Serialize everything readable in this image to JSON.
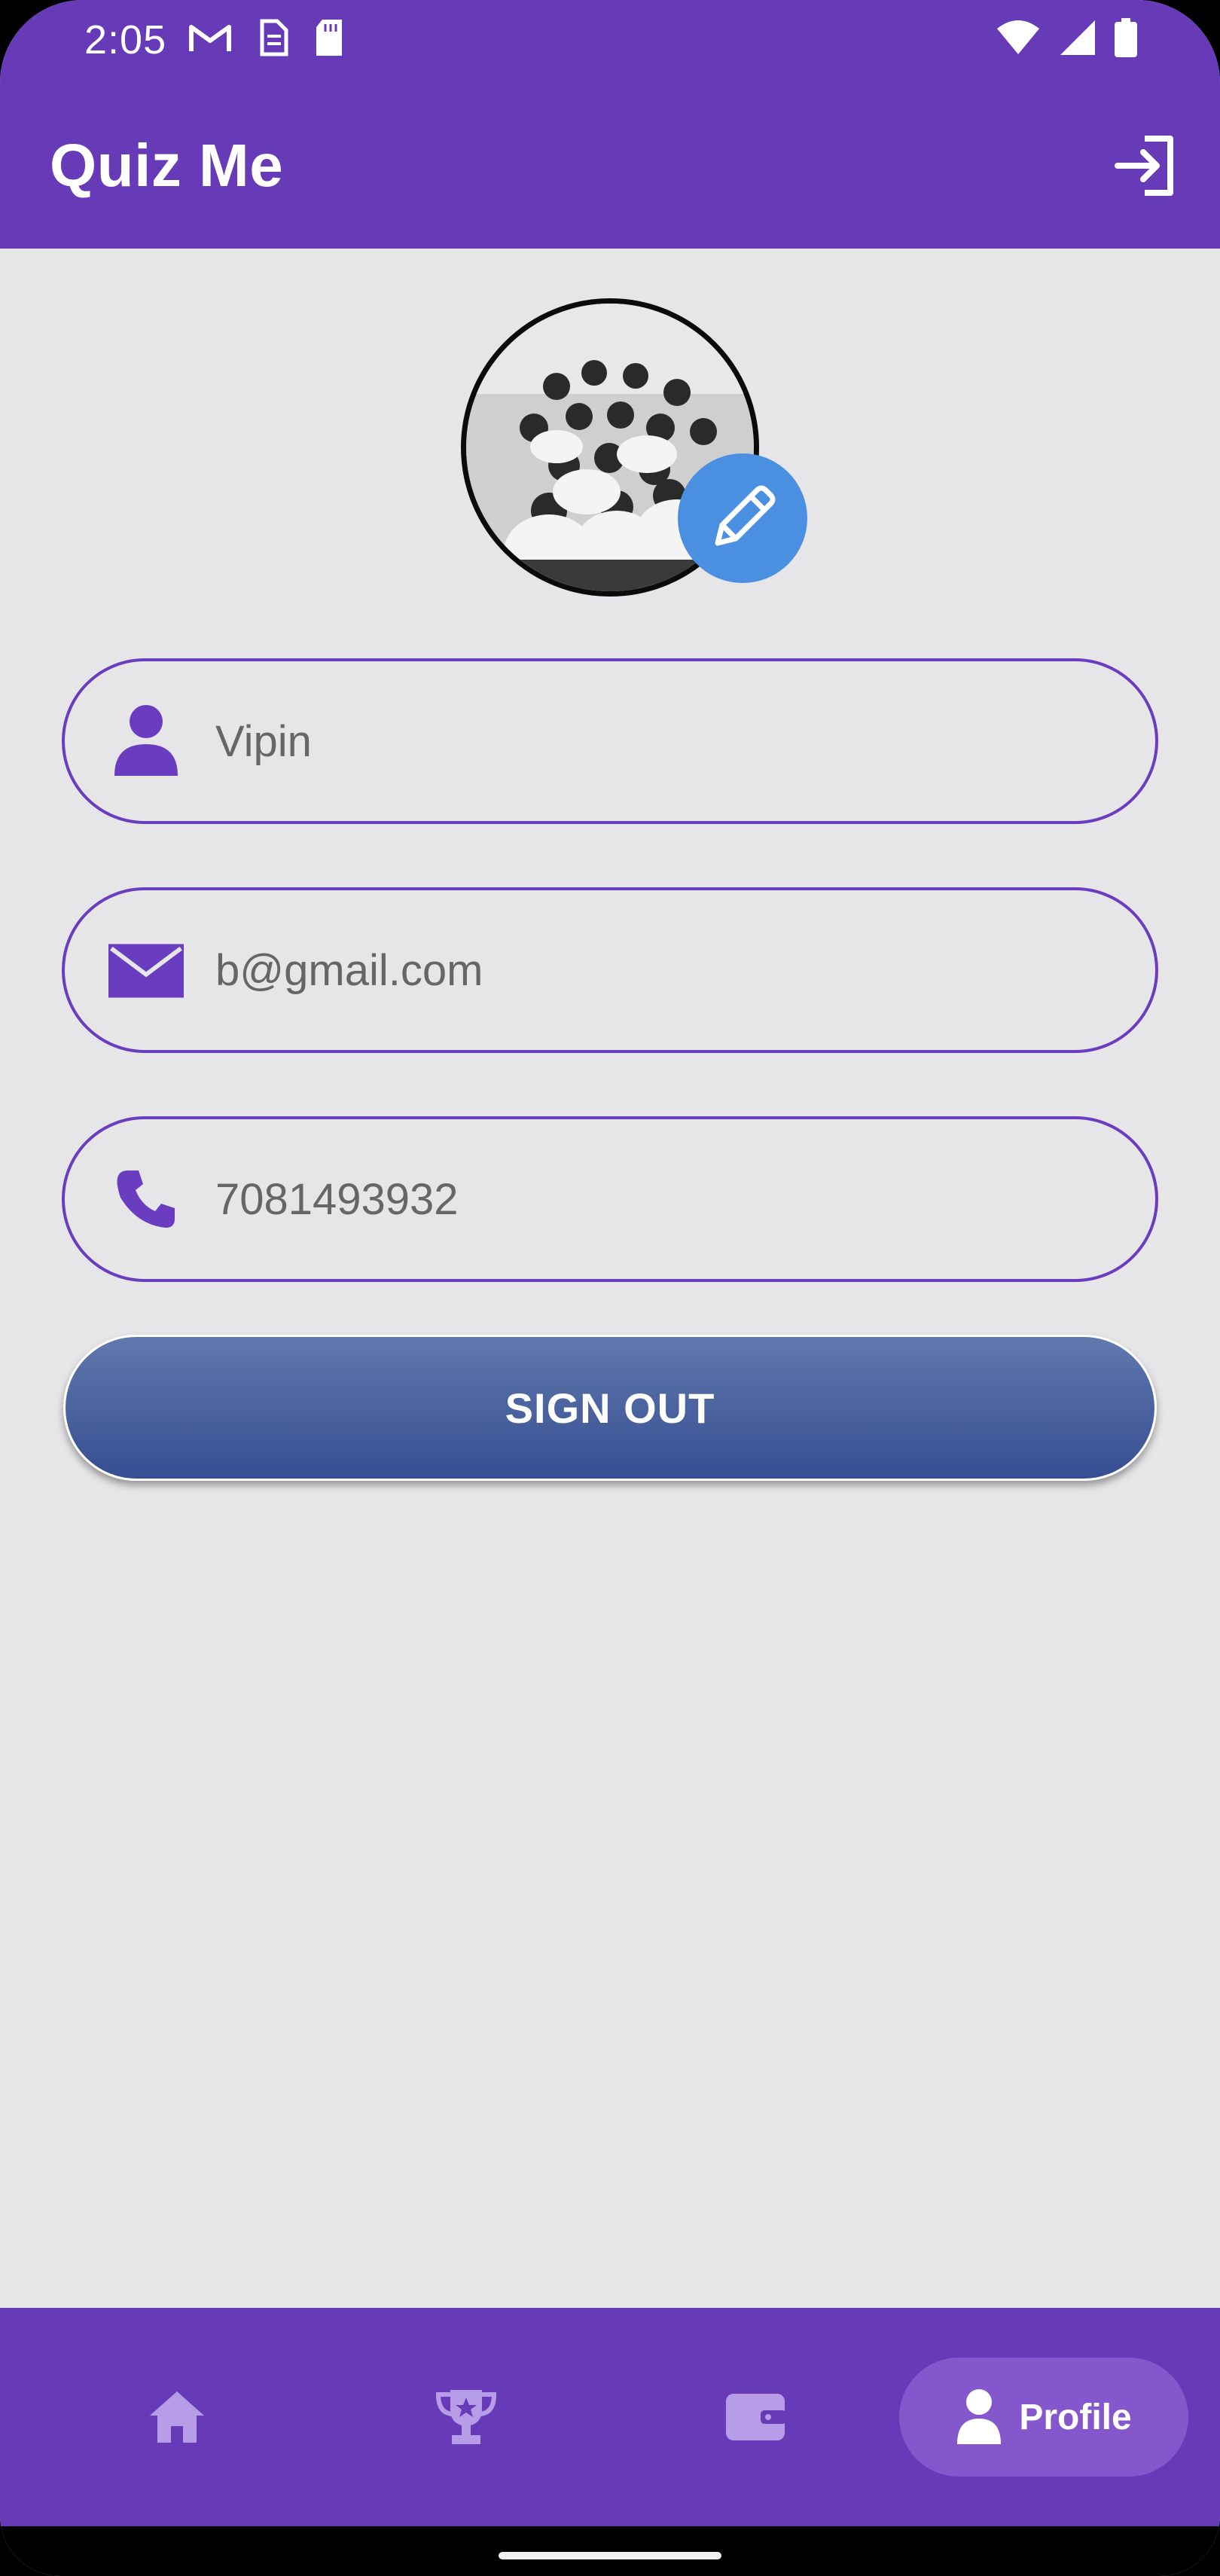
{
  "status_bar": {
    "time": "2:05",
    "left_icons": [
      "gmail-icon",
      "sim-icon",
      "sd-card-icon"
    ],
    "right_icons": [
      "wifi-icon",
      "signal-icon",
      "battery-icon"
    ]
  },
  "app_bar": {
    "title": "Quiz Me",
    "action_icon": "sign-out-icon"
  },
  "profile": {
    "avatar": "group-photo",
    "edit_icon": "pencil-icon"
  },
  "fields": {
    "name": {
      "value": "Vipin",
      "icon": "person-icon"
    },
    "email": {
      "value": "b@gmail.com",
      "icon": "mail-icon"
    },
    "phone": {
      "value": "7081493932",
      "icon": "phone-icon"
    }
  },
  "actions": {
    "sign_out_label": "SIGN OUT"
  },
  "bottom_nav": {
    "items": [
      {
        "icon": "home-icon"
      },
      {
        "icon": "trophy-icon"
      },
      {
        "icon": "wallet-icon"
      },
      {
        "icon": "person-icon",
        "label": "Profile",
        "selected": true
      }
    ]
  },
  "colors": {
    "primary": "#673AB7",
    "accent_border": "#6A3CC0",
    "edit_button": "#4A8FE0",
    "signout_top": "#6179AD",
    "signout_bottom": "#354E92",
    "background": "#E6E6E8",
    "nav_selected": "#8457CC"
  }
}
